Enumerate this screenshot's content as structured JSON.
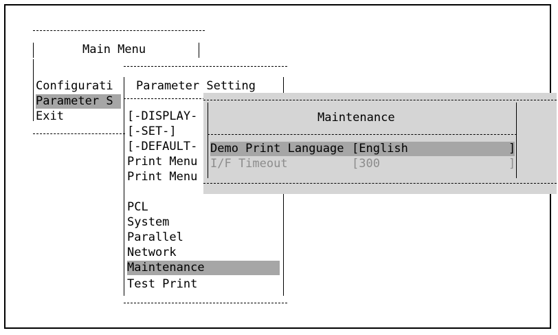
{
  "main_menu": {
    "title": "Main Menu",
    "items": [
      "Configurati",
      "Parameter S",
      "Exit"
    ],
    "selected_index": 1
  },
  "parameter_menu": {
    "title": "Parameter Setting",
    "items": [
      "[-DISPLAY-",
      "[-SET-]",
      "[-DEFAULT-",
      "Print Menu",
      "Print Menu",
      "PCL",
      "System",
      "Parallel",
      "Network",
      "Maintenance",
      "Test Print"
    ],
    "selected_index": 9
  },
  "maintenance_dialog": {
    "title": "Maintenance",
    "rows": [
      {
        "label": "Demo Print Language",
        "value": "[English",
        "close": "]",
        "selected": true
      },
      {
        "label": "I/F Timeout",
        "value": "[300",
        "close": "]",
        "selected": false
      }
    ]
  },
  "colors": {
    "highlight": "#a6a6a6",
    "dialog_background": "#d5d5d5",
    "dim_text": "#8c8c8c"
  }
}
